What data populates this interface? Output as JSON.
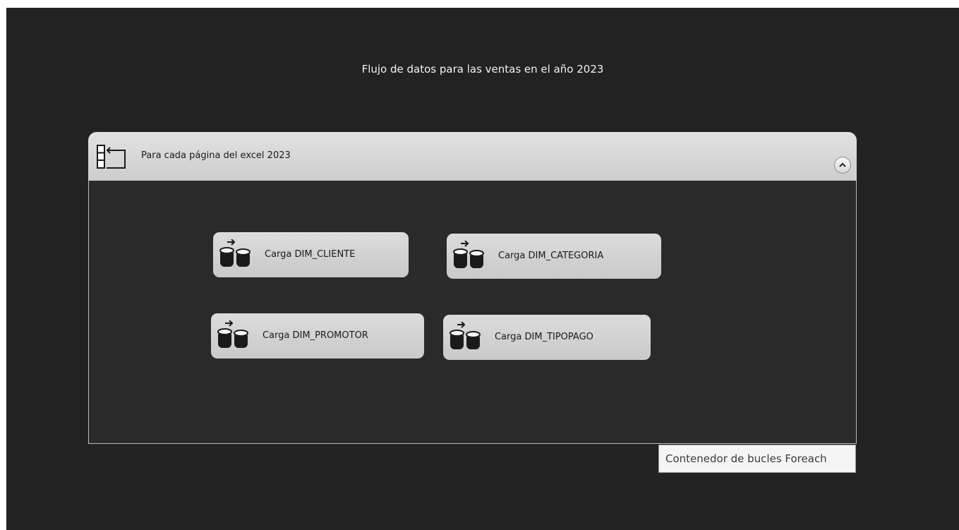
{
  "flow": {
    "title": "Flujo de datos para las ventas en el año 2023"
  },
  "container": {
    "title": "Para cada página del excel 2023",
    "icon": "foreach-loop-icon",
    "collapse_icon": "chevron-up-icon",
    "tasks": [
      {
        "label": "Carga DIM_CLIENTE",
        "icon": "data-flow-task-icon"
      },
      {
        "label": "Carga DIM_CATEGORIA",
        "icon": "data-flow-task-icon"
      },
      {
        "label": "Carga DIM_PROMOTOR",
        "icon": "data-flow-task-icon"
      },
      {
        "label": "Carga DIM_TIPOPAGO",
        "icon": "data-flow-task-icon"
      }
    ]
  },
  "tooltip": {
    "text": "Contenedor de bucles Foreach"
  },
  "colors": {
    "canvas": "#222222",
    "container_body": "#2a2a2a",
    "header": "#d4d4d4",
    "task_fill": "#d2d2d2"
  }
}
